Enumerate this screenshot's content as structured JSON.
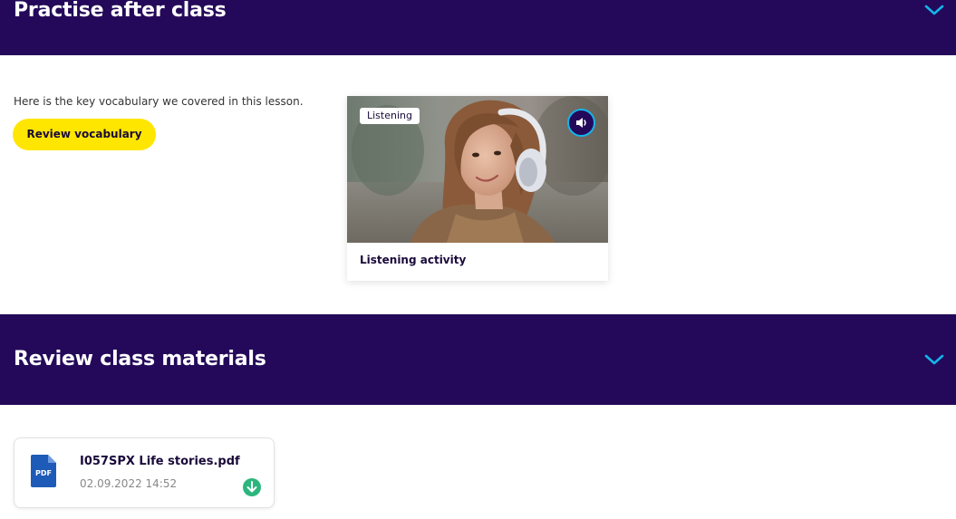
{
  "colors": {
    "header_bg": "#24095a",
    "accent_cyan": "#13b5ea",
    "button_yellow": "#ffe600",
    "download_green": "#2cb67d",
    "pdf_blue": "#1e5bb8"
  },
  "practise": {
    "title": "Practise after class",
    "chevron_icon": "chevron-down-icon",
    "intro_text": "Here is the key vocabulary we covered in this lesson.",
    "review_button_label": "Review vocabulary",
    "activity": {
      "badge": "Listening",
      "title": "Listening activity",
      "audio_icon": "speaker-icon"
    }
  },
  "review_materials": {
    "title": "Review class materials",
    "chevron_icon": "chevron-down-icon",
    "files": [
      {
        "name": "I057SPX Life stories.pdf",
        "date": "02.09.2022 14:52",
        "type_label": "PDF",
        "download_icon": "download-icon"
      }
    ]
  }
}
